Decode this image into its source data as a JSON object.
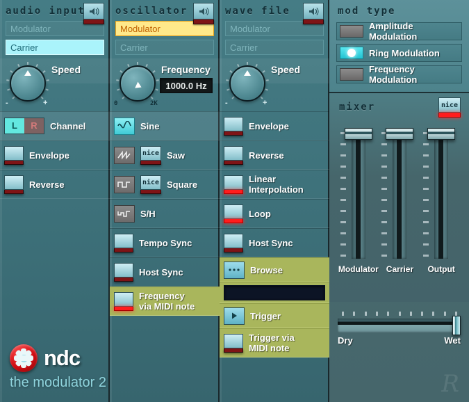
{
  "panels": {
    "audio_input": {
      "title": "audio input",
      "speaker_icon": "speaker-icon",
      "sources": [
        {
          "label": "Modulator",
          "state": "off"
        },
        {
          "label": "Carrier",
          "state": "selected-cyan"
        }
      ],
      "knob": {
        "label": "Speed",
        "minus": "-",
        "plus": "+"
      },
      "rows": [
        {
          "label": "Channel",
          "type": "lr",
          "left": "L",
          "right": "R"
        },
        {
          "label": "Envelope",
          "type": "toggle",
          "led": "off"
        },
        {
          "label": "Reverse",
          "type": "toggle",
          "led": "off"
        }
      ]
    },
    "oscillator": {
      "title": "oscillator",
      "speaker_icon": "speaker-icon",
      "sources": [
        {
          "label": "Modulator",
          "state": "selected-yellow"
        },
        {
          "label": "Carrier",
          "state": "off"
        }
      ],
      "knob": {
        "label": "Frequency",
        "value": "1000.0 Hz",
        "min": "0",
        "max": "2K"
      },
      "rows": [
        {
          "label": "Sine",
          "icon": "sine-wave-icon",
          "icon_on": true,
          "nice": false,
          "lit": true
        },
        {
          "label": "Saw",
          "icon": "saw-wave-icon",
          "icon_on": false,
          "nice": true,
          "nice_label": "nice",
          "nice_led": "off"
        },
        {
          "label": "Square",
          "icon": "square-wave-icon",
          "icon_on": false,
          "nice": true,
          "nice_label": "nice",
          "nice_led": "off"
        },
        {
          "label": "S/H",
          "icon": "sample-hold-icon",
          "icon_on": false,
          "nice": false
        },
        {
          "label": "Tempo Sync",
          "type": "toggle",
          "led": "off"
        },
        {
          "label": "Host Sync",
          "type": "toggle",
          "led": "off"
        },
        {
          "label": "Frequency\nvia MIDI note",
          "type": "toggle",
          "led": "on",
          "highlight": "olive"
        }
      ]
    },
    "wave_file": {
      "title": "wave file",
      "speaker_icon": "speaker-icon",
      "sources": [
        {
          "label": "Modulator",
          "state": "off"
        },
        {
          "label": "Carrier",
          "state": "off"
        }
      ],
      "knob": {
        "label": "Speed",
        "minus": "-",
        "plus": "+"
      },
      "rows": [
        {
          "label": "Envelope",
          "led": "off"
        },
        {
          "label": "Reverse",
          "led": "off"
        },
        {
          "label": "Linear\nInterpolation",
          "led": "on"
        },
        {
          "label": "Loop",
          "led": "on"
        },
        {
          "label": "Host Sync",
          "led": "off"
        }
      ],
      "browse": {
        "label": "Browse",
        "icon": "ellipsis-icon",
        "highlight": "olive"
      },
      "file_display": {
        "value": ""
      },
      "trigger": {
        "label": "Trigger",
        "icon": "play-icon",
        "highlight": "olive"
      },
      "trigger_midi": {
        "label": "Trigger via\nMIDI note",
        "led": "off",
        "highlight": "olive"
      }
    },
    "mod_type": {
      "title": "mod type",
      "options": [
        {
          "label": "Amplitude Modulation",
          "selected": false
        },
        {
          "label": "Ring Modulation",
          "selected": true
        },
        {
          "label": "Frequency Modulation",
          "selected": false
        }
      ]
    },
    "mixer": {
      "title": "mixer",
      "nice": {
        "label": "nice",
        "led": "on"
      },
      "faders": [
        {
          "label": "Modulator",
          "position_pct": 100
        },
        {
          "label": "Carrier",
          "position_pct": 100
        },
        {
          "label": "Output",
          "position_pct": 100
        }
      ]
    },
    "drywet": {
      "left_label": "Dry",
      "right_label": "Wet",
      "position_pct": 100
    }
  },
  "brand": {
    "name": "ndc",
    "product": "the modulator 2",
    "logo_icon": "ndc-star-logo-icon",
    "watermark": "R"
  },
  "colors": {
    "background": "#3c7079",
    "panel_dark": "#46666b",
    "accent_cyan": "#aaf3fb",
    "accent_yellow": "#ffe98a",
    "olive": "#a9b65c",
    "led_on": "#ff1d1d",
    "led_off": "#7e1416",
    "logo_red": "#cf0c12"
  }
}
